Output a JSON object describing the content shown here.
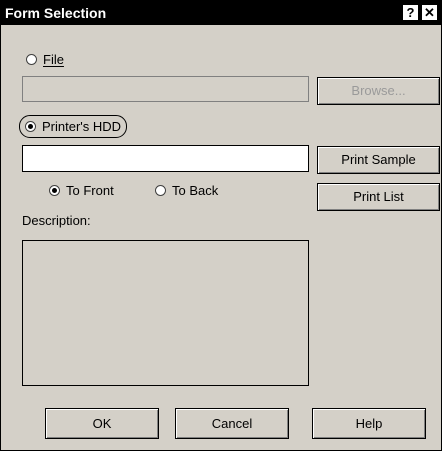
{
  "window": {
    "title": "Form Selection",
    "help_glyph": "?",
    "close_glyph": "✕"
  },
  "file_option": {
    "label": "File",
    "selected": false
  },
  "file_path": {
    "value": ""
  },
  "browse_button": {
    "label": "Browse...",
    "enabled": false
  },
  "hdd_option": {
    "label": "Printer's HDD",
    "selected": true
  },
  "hdd_input": {
    "value": ""
  },
  "print_sample_button": {
    "label": "Print Sample"
  },
  "print_list_button": {
    "label": "Print List"
  },
  "position": {
    "to_front": {
      "label": "To Front",
      "selected": true
    },
    "to_back": {
      "label": "To Back",
      "selected": false
    }
  },
  "description": {
    "label": "Description:",
    "text": ""
  },
  "footer": {
    "ok_label": "OK",
    "cancel_label": "Cancel",
    "help_label": "Help"
  },
  "colors": {
    "dialog_bg": "#d4d0c8",
    "titlebar_bg": "#000000",
    "titlebar_text": "#ffffff",
    "disabled_text": "#9a9a9a"
  }
}
